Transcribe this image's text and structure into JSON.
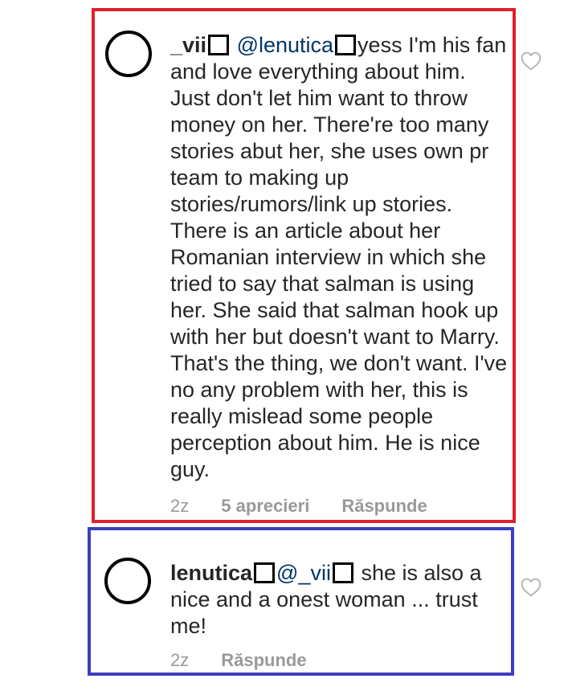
{
  "comments": [
    {
      "username": "_vii",
      "mention": "@lenutica",
      "text": "yess I'm his fan and love everything about him. Just don't let him want to throw money on her. There're too many stories abut her, she uses own pr team to making up stories/rumors/link up stories. There is an article about her Romanian  interview in which she tried to say that salman is using her. She said that salman hook up with her but doesn't want to Marry. That's the thing, we don't want. I've no any problem with her, this is really mislead some people perception about him. He is nice guy.",
      "time": "2z",
      "likes": "5 aprecieri",
      "reply_label": "Răspunde"
    },
    {
      "username": "lenutica",
      "mention": "@_vii",
      "text": "she is also a nice and a onest woman ... trust me!",
      "time": "2z",
      "reply_label": "Răspunde"
    }
  ],
  "icons": {
    "like": "heart-outline-icon"
  },
  "colors": {
    "highlight_red": "#e0202b",
    "highlight_blue": "#3c3fbf",
    "mention": "#003569",
    "meta_gray": "#999999"
  }
}
